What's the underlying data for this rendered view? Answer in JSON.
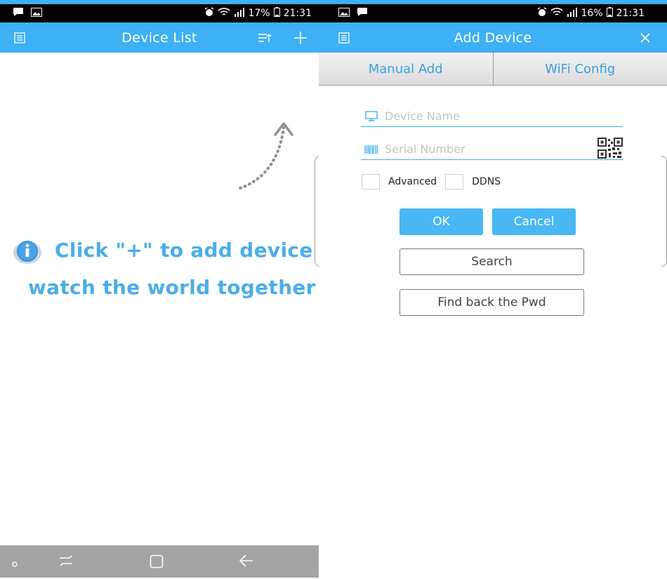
{
  "left_phone": {
    "status": {
      "battery_pct": "17%",
      "time": "21:31",
      "left_icons": [
        "chat-icon",
        "image-icon"
      ]
    },
    "app_bar": {
      "title": "Device List",
      "menu_icon": "list-icon",
      "sort_icon": "sort-icon",
      "add_icon": "plus-icon"
    },
    "hint": {
      "line1": "Click \"+\" to add device",
      "line2": "watch the world together",
      "icon": "info-icon"
    },
    "nav": {
      "icons": [
        "dot-icon",
        "recent-apps-icon",
        "home-icon",
        "back-icon"
      ]
    }
  },
  "right_phone": {
    "status": {
      "battery_pct": "16%",
      "time": "21:31",
      "left_icons": [
        "image-icon",
        "chat-icon"
      ]
    },
    "app_bar": {
      "title": "Add Device",
      "menu_icon": "list-icon",
      "close_icon": "close-icon"
    },
    "tabs": [
      {
        "label": "Manual Add",
        "selected": true
      },
      {
        "label": "WiFi Config",
        "selected": false
      }
    ],
    "form": {
      "device_name": {
        "value": "",
        "placeholder": "Device Name",
        "icon": "monitor-icon"
      },
      "serial_number": {
        "value": "",
        "placeholder": "Serial Number",
        "icon": "barcode-icon",
        "action_icon": "qr-code-icon"
      },
      "checks": [
        {
          "label": "Advanced",
          "checked": false
        },
        {
          "label": "DDNS",
          "checked": false
        }
      ],
      "ok_label": "OK",
      "cancel_label": "Cancel",
      "search_label": "Search",
      "find_pwd_label": "Find back the Pwd"
    }
  },
  "colors": {
    "accent": "#3eb0f4",
    "hint_text": "#4aaee8",
    "button_blue": "#48b7f3",
    "nav_gray": "#a4a4a4"
  }
}
